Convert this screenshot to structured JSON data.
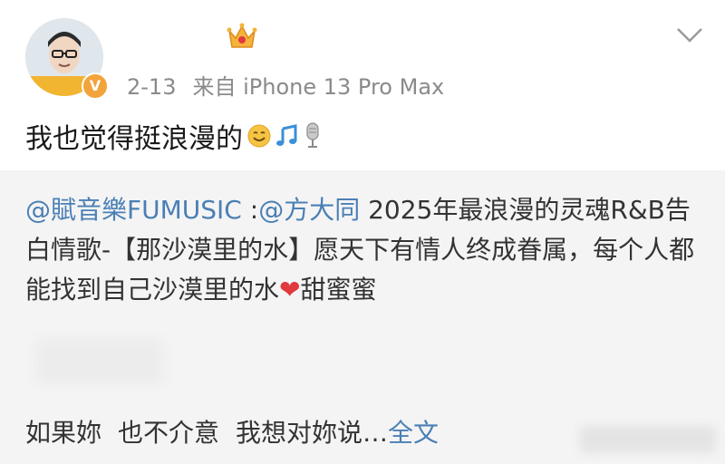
{
  "post": {
    "username": "",
    "timestamp": "2-13",
    "source": "来自 iPhone 13 Pro Max",
    "text": "我也觉得挺浪漫的",
    "emojis": [
      "smile-emoji",
      "music-note-emoji",
      "microphone-emoji"
    ],
    "verified_badge": "V"
  },
  "repost": {
    "mention_1": "@賦音樂FUMUSIC",
    "separator": " :",
    "mention_2": "@方大同",
    "body_1": " 2025年最浪漫的灵魂R&B告白情歌-【那沙漠里的水】愿天下有情人终成眷属，每个人都能找到自己沙漠里的水",
    "heart": "❤",
    "body_2": "甜蜜蜜",
    "last_line_a": "如果妳",
    "last_line_b": "也不介意",
    "last_line_c": "我想对妳说…",
    "full_text_link": "全文"
  },
  "colors": {
    "link": "#4a7fb5",
    "badge": "#f2a33a",
    "repost_bg": "#f4f4f4",
    "meta_text": "#8a8a8a"
  }
}
